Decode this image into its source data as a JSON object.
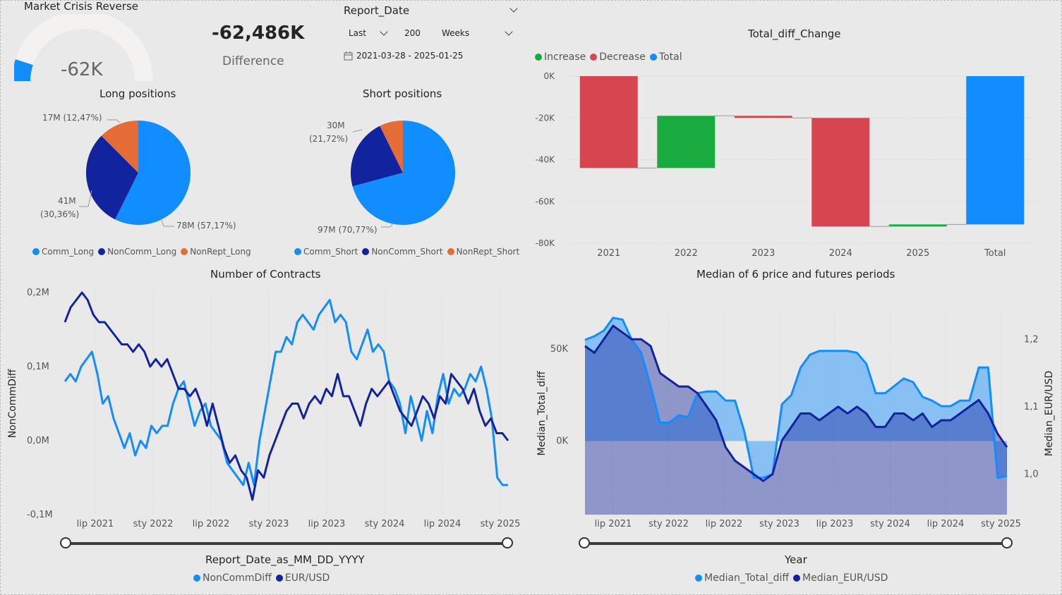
{
  "gauge": {
    "title": "Market Crisis Reverse",
    "value_label": "-62K",
    "fraction": 0.1
  },
  "kpi": {
    "value": "-62,486K",
    "label": "Difference"
  },
  "slicer": {
    "title": "Report_Date",
    "mode": "Last",
    "count": "200",
    "unit": "Weeks",
    "date_range": "2021-03-28 - 2025-01-25"
  },
  "colors": {
    "comm": "#118dff",
    "noncomm": "#12239e",
    "nonrept": "#e66c37",
    "increase": "#1aab40",
    "decrease": "#d64550",
    "total": "#118dff",
    "line_light": "#118dff",
    "line_dark": "#12239e"
  },
  "long_pie": {
    "title": "Long positions",
    "labels": {
      "nonrept": "17M (12,47%)",
      "noncomm_a": "41M",
      "noncomm_b": "(30,36%)",
      "comm": "78M (57,17%)"
    },
    "legend": [
      "Comm_Long",
      "NonComm_Long",
      "NonRept_Long"
    ]
  },
  "short_pie": {
    "title": "Short positions",
    "labels": {
      "noncomm_a": "30M",
      "noncomm_b": "(21,72%)",
      "comm": "97M (70,77%)"
    },
    "legend": [
      "Comm_Short",
      "NonComm_Short",
      "NonRept_Short"
    ]
  },
  "waterfall_legend": [
    "Increase",
    "Decrease",
    "Total"
  ],
  "lines_legend": [
    "NonCommDiff",
    "EUR/USD"
  ],
  "area_legend": [
    "Median_Total_diff",
    "Median_EUR/USD"
  ],
  "chart_data": [
    {
      "type": "pie",
      "title": "Long positions",
      "categories": [
        "Comm_Long",
        "NonComm_Long",
        "NonRept_Long"
      ],
      "values": [
        78,
        41,
        17
      ],
      "percent": [
        57.17,
        30.36,
        12.47
      ]
    },
    {
      "type": "pie",
      "title": "Short positions",
      "categories": [
        "Comm_Short",
        "NonComm_Short",
        "NonRept_Short"
      ],
      "values": [
        97,
        30,
        10
      ],
      "percent": [
        70.77,
        21.72,
        7.51
      ]
    },
    {
      "type": "bar",
      "subtype": "waterfall",
      "title": "Total_diff_Change",
      "categories": [
        "2021",
        "2022",
        "2023",
        "2024",
        "2025",
        "Total"
      ],
      "start": [
        0,
        -44,
        -19,
        -20,
        -72,
        0
      ],
      "end": [
        -44,
        -19,
        -20,
        -72,
        -71,
        -71
      ],
      "kind": [
        "decrease",
        "increase",
        "decrease",
        "decrease",
        "increase",
        "total"
      ],
      "yticks": [
        "0K",
        "-20K",
        "-40K",
        "-60K",
        "-80K"
      ],
      "ylim": [
        -80,
        0
      ]
    },
    {
      "type": "line",
      "title": "Number of Contracts",
      "xlabel": "Report_Date_as_MM_DD_YYYY",
      "ylabel": "NonCommDiff",
      "xticks": [
        "lip 2021",
        "sty 2022",
        "lip 2022",
        "sty 2023",
        "lip 2023",
        "sty 2024",
        "lip 2024",
        "sty 2025"
      ],
      "yticks": [
        "0,2M",
        "0,1M",
        "0,0M",
        "-0,1M"
      ],
      "ylim": [
        -0.1,
        0.2
      ],
      "series": [
        {
          "name": "NonCommDiff",
          "x_range": [
            "2021-03-28",
            "2025-01-25"
          ],
          "values": [
            0.08,
            0.09,
            0.08,
            0.1,
            0.11,
            0.12,
            0.09,
            0.05,
            0.06,
            0.03,
            0.01,
            -0.01,
            0.01,
            -0.02,
            0.0,
            -0.01,
            0.02,
            0.01,
            0.02,
            0.02,
            0.05,
            0.07,
            0.08,
            0.05,
            0.02,
            0.04,
            0.05,
            0.02,
            0.01,
            0.0,
            -0.03,
            -0.04,
            -0.05,
            -0.06,
            -0.03,
            -0.06,
            0.0,
            0.04,
            0.08,
            0.12,
            0.12,
            0.14,
            0.13,
            0.16,
            0.17,
            0.16,
            0.15,
            0.17,
            0.18,
            0.19,
            0.16,
            0.17,
            0.16,
            0.12,
            0.11,
            0.13,
            0.15,
            0.12,
            0.13,
            0.12,
            0.08,
            0.07,
            0.05,
            0.01,
            0.06,
            0.03,
            0.0,
            0.04,
            0.01,
            0.06,
            0.09,
            0.05,
            0.07,
            0.06,
            0.07,
            0.09,
            0.08,
            0.1,
            0.07,
            0.03,
            -0.05,
            -0.06,
            -0.06
          ]
        },
        {
          "name": "EUR/USD",
          "x_range": [
            "2021-03-28",
            "2025-01-25"
          ],
          "values": [
            0.16,
            0.18,
            0.19,
            0.2,
            0.19,
            0.17,
            0.16,
            0.16,
            0.15,
            0.14,
            0.13,
            0.13,
            0.12,
            0.13,
            0.12,
            0.1,
            0.11,
            0.1,
            0.11,
            0.09,
            0.07,
            0.07,
            0.06,
            0.07,
            0.05,
            0.02,
            0.05,
            0.02,
            -0.01,
            -0.03,
            -0.02,
            -0.04,
            -0.05,
            -0.08,
            -0.04,
            -0.05,
            -0.02,
            0.0,
            0.02,
            0.04,
            0.05,
            0.05,
            0.03,
            0.05,
            0.06,
            0.05,
            0.07,
            0.06,
            0.09,
            0.06,
            0.06,
            0.04,
            0.02,
            0.05,
            0.07,
            0.06,
            0.07,
            0.08,
            0.06,
            0.04,
            0.03,
            0.02,
            0.04,
            0.06,
            0.05,
            0.03,
            0.06,
            0.05,
            0.09,
            0.08,
            0.07,
            0.05,
            0.07,
            0.04,
            0.02,
            0.03,
            0.01,
            0.01,
            0.0
          ]
        }
      ]
    },
    {
      "type": "area",
      "title": "Median of 6 price and futures periods",
      "xlabel": "Year",
      "ylabel_left": "Median_Total_diff",
      "ylabel_right": "Median_EUR/USD",
      "xticks": [
        "lip 2021",
        "sty 2022",
        "lip 2022",
        "sty 2023",
        "lip 2023",
        "sty 2024",
        "lip 2024",
        "sty 2025"
      ],
      "yticks_left": [
        "50K",
        "0K"
      ],
      "yticks_right": [
        "1,2",
        "1,1",
        "1,0"
      ],
      "series": [
        {
          "name": "Median_Total_diff",
          "axis": "left",
          "x_range": [
            "2021-03-28",
            "2025-01-25"
          ],
          "values": [
            55,
            57,
            60,
            67,
            66,
            55,
            48,
            30,
            10,
            10,
            14,
            13,
            26,
            27,
            27,
            22,
            22,
            5,
            -20,
            -20,
            -18,
            20,
            25,
            40,
            47,
            49,
            49,
            49,
            49,
            48,
            42,
            26,
            26,
            30,
            34,
            32,
            24,
            22,
            19,
            19,
            22,
            22,
            40,
            40,
            -20,
            -19
          ]
        },
        {
          "name": "Median_EUR/USD",
          "axis": "right",
          "x_range": [
            "2021-03-28",
            "2025-01-25"
          ],
          "values": [
            1.19,
            1.18,
            1.2,
            1.22,
            1.21,
            1.2,
            1.2,
            1.19,
            1.15,
            1.14,
            1.13,
            1.13,
            1.12,
            1.1,
            1.08,
            1.04,
            1.02,
            1.01,
            1.0,
            0.99,
            1.0,
            1.05,
            1.07,
            1.09,
            1.09,
            1.08,
            1.09,
            1.1,
            1.09,
            1.1,
            1.09,
            1.07,
            1.07,
            1.09,
            1.09,
            1.08,
            1.09,
            1.07,
            1.08,
            1.08,
            1.09,
            1.1,
            1.11,
            1.09,
            1.06,
            1.04
          ]
        }
      ]
    }
  ]
}
